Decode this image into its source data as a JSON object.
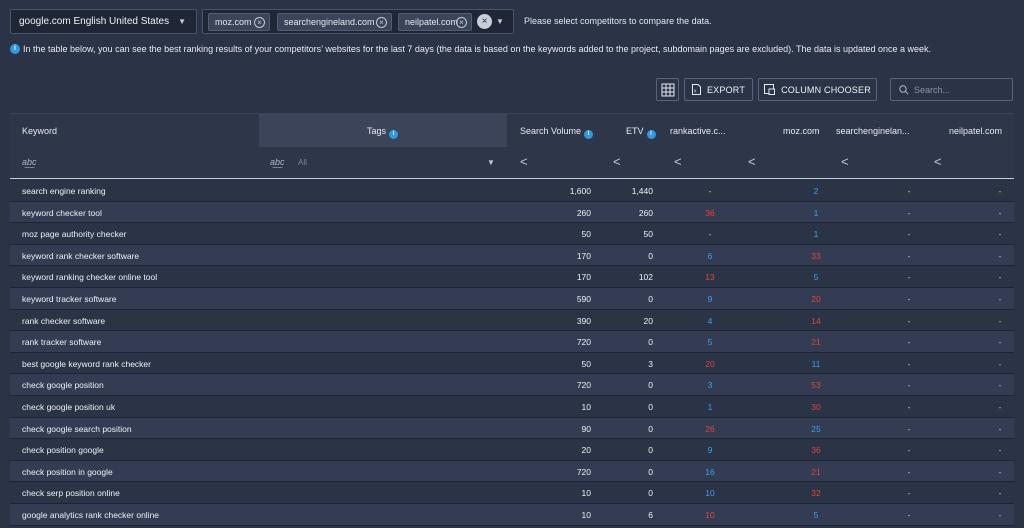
{
  "topbar": {
    "engine": "google.com English United States",
    "competitors": [
      "moz.com",
      "searchengineland.com",
      "neilpatel.com"
    ],
    "hint": "Please select competitors to compare the data."
  },
  "info_text": "In the table below, you can see the best ranking results of your competitors’ websites for the last 7 days (the data is based on the keywords added to the project, subdomain pages are excluded). The data is updated once a week.",
  "toolbar": {
    "export_label": "EXPORT",
    "column_chooser_label": "COLUMN CHOOSER",
    "search_placeholder": "Search..."
  },
  "table": {
    "headers": {
      "keyword": "Keyword",
      "tags": "Tags",
      "search_volume": "Search Volume",
      "etv": "ETV",
      "rankactive": "rankactive.c...",
      "moz": "moz.com",
      "searchengineland": "searchenginelan...",
      "neilpatel": "neilpatel.com"
    },
    "filters": {
      "abc": "a͟b͟c",
      "tags_all": "All",
      "lt": "<"
    },
    "rows": [
      {
        "keyword": "search engine ranking",
        "sv": "1,600",
        "etv": "1,440",
        "rank": "-",
        "rank_color": "dash",
        "moz": "2",
        "moz_color": "blue",
        "sel": "-",
        "np": "-"
      },
      {
        "keyword": "keyword checker tool",
        "sv": "260",
        "etv": "260",
        "rank": "36",
        "rank_color": "red",
        "moz": "1",
        "moz_color": "blue",
        "sel": "-",
        "np": "-"
      },
      {
        "keyword": "moz page authority checker",
        "sv": "50",
        "etv": "50",
        "rank": "-",
        "rank_color": "dash",
        "moz": "1",
        "moz_color": "blue",
        "sel": "-",
        "np": "-"
      },
      {
        "keyword": "keyword rank checker software",
        "sv": "170",
        "etv": "0",
        "rank": "6",
        "rank_color": "blue",
        "moz": "33",
        "moz_color": "red",
        "sel": "-",
        "np": "-"
      },
      {
        "keyword": "keyword ranking checker online tool",
        "sv": "170",
        "etv": "102",
        "rank": "13",
        "rank_color": "red",
        "moz": "5",
        "moz_color": "blue",
        "sel": "-",
        "np": "-"
      },
      {
        "keyword": "keyword tracker software",
        "sv": "590",
        "etv": "0",
        "rank": "9",
        "rank_color": "blue",
        "moz": "20",
        "moz_color": "red",
        "sel": "-",
        "np": "-"
      },
      {
        "keyword": "rank checker software",
        "sv": "390",
        "etv": "20",
        "rank": "4",
        "rank_color": "blue",
        "moz": "14",
        "moz_color": "red",
        "sel": "-",
        "np": "-"
      },
      {
        "keyword": "rank tracker software",
        "sv": "720",
        "etv": "0",
        "rank": "5",
        "rank_color": "blue",
        "moz": "21",
        "moz_color": "red",
        "sel": "-",
        "np": "-"
      },
      {
        "keyword": "best google keyword rank checker",
        "sv": "50",
        "etv": "3",
        "rank": "20",
        "rank_color": "red",
        "moz": "11",
        "moz_color": "blue",
        "sel": "-",
        "np": "-"
      },
      {
        "keyword": "check google position",
        "sv": "720",
        "etv": "0",
        "rank": "3",
        "rank_color": "blue",
        "moz": "53",
        "moz_color": "red",
        "sel": "-",
        "np": "-"
      },
      {
        "keyword": "check google position uk",
        "sv": "10",
        "etv": "0",
        "rank": "1",
        "rank_color": "blue",
        "moz": "30",
        "moz_color": "red",
        "sel": "-",
        "np": "-"
      },
      {
        "keyword": "check google search position",
        "sv": "90",
        "etv": "0",
        "rank": "26",
        "rank_color": "red",
        "moz": "25",
        "moz_color": "blue",
        "sel": "-",
        "np": "-"
      },
      {
        "keyword": "check position google",
        "sv": "20",
        "etv": "0",
        "rank": "9",
        "rank_color": "blue",
        "moz": "36",
        "moz_color": "red",
        "sel": "-",
        "np": "-"
      },
      {
        "keyword": "check position in google",
        "sv": "720",
        "etv": "0",
        "rank": "16",
        "rank_color": "blue",
        "moz": "21",
        "moz_color": "red",
        "sel": "-",
        "np": "-"
      },
      {
        "keyword": "check serp position online",
        "sv": "10",
        "etv": "0",
        "rank": "10",
        "rank_color": "blue",
        "moz": "32",
        "moz_color": "red",
        "sel": "-",
        "np": "-"
      },
      {
        "keyword": "google analytics rank checker online",
        "sv": "10",
        "etv": "6",
        "rank": "10",
        "rank_color": "red",
        "moz": "5",
        "moz_color": "blue",
        "sel": "-",
        "np": "-"
      }
    ]
  },
  "colors": {
    "red": "#e0463b",
    "blue": "#36a3ea",
    "background": "#2b3346"
  }
}
